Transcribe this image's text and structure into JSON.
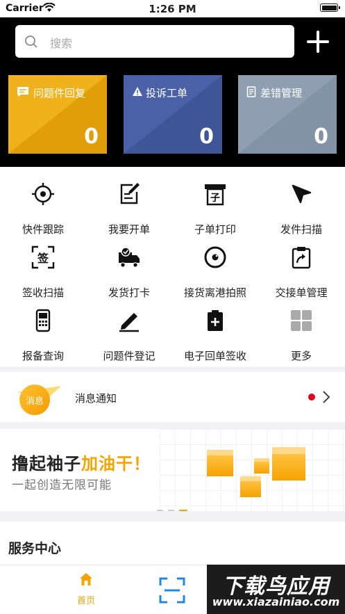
{
  "status_bar": {
    "carrier": "Carrier",
    "time": "1:26 PM"
  },
  "header": {
    "search_placeholder": "搜索",
    "cards": [
      {
        "label": "问题件回复",
        "value": "0",
        "color": "#f0b21c",
        "icon": "message-icon"
      },
      {
        "label": "投诉工单",
        "value": "0",
        "color": "#4a61a7",
        "icon": "warning-icon"
      },
      {
        "label": "差错管理",
        "value": "0",
        "color": "#8f9fb1",
        "icon": "document-icon"
      }
    ]
  },
  "menu": {
    "items": [
      {
        "label": "快件跟踪",
        "icon": "target-icon"
      },
      {
        "label": "我要开单",
        "icon": "edit-form-icon"
      },
      {
        "label": "子单打印",
        "icon": "printer-icon"
      },
      {
        "label": "发件扫描",
        "icon": "send-arrow-icon"
      },
      {
        "label": "签收扫描",
        "icon": "sign-scan-icon"
      },
      {
        "label": "发货打卡",
        "icon": "truck-check-icon"
      },
      {
        "label": "接货离港拍照",
        "icon": "camera-lens-icon"
      },
      {
        "label": "交接单管理",
        "icon": "clipboard-share-icon"
      },
      {
        "label": "报备查询",
        "icon": "calculator-icon"
      },
      {
        "label": "问题件登记",
        "icon": "pencil-icon"
      },
      {
        "label": "电子回单签收",
        "icon": "clipboard-plus-icon"
      },
      {
        "label": "更多",
        "icon": "grid-more-icon"
      }
    ]
  },
  "notice": {
    "badge": "消息",
    "title": "消息通知"
  },
  "banner": {
    "title_main": "撸起袖子",
    "title_accent": "加油干！",
    "subtitle": "一起创造无限可能"
  },
  "service": {
    "title": "服务中心"
  },
  "tab_bar": {
    "home_label": "首页"
  },
  "watermark": {
    "main": "下载鸟应用",
    "sub": "www.xiazainiao.com"
  },
  "colors": {
    "accent": "#f5a300",
    "header_bg": "#000000",
    "notice_dot": "#e0001a"
  }
}
